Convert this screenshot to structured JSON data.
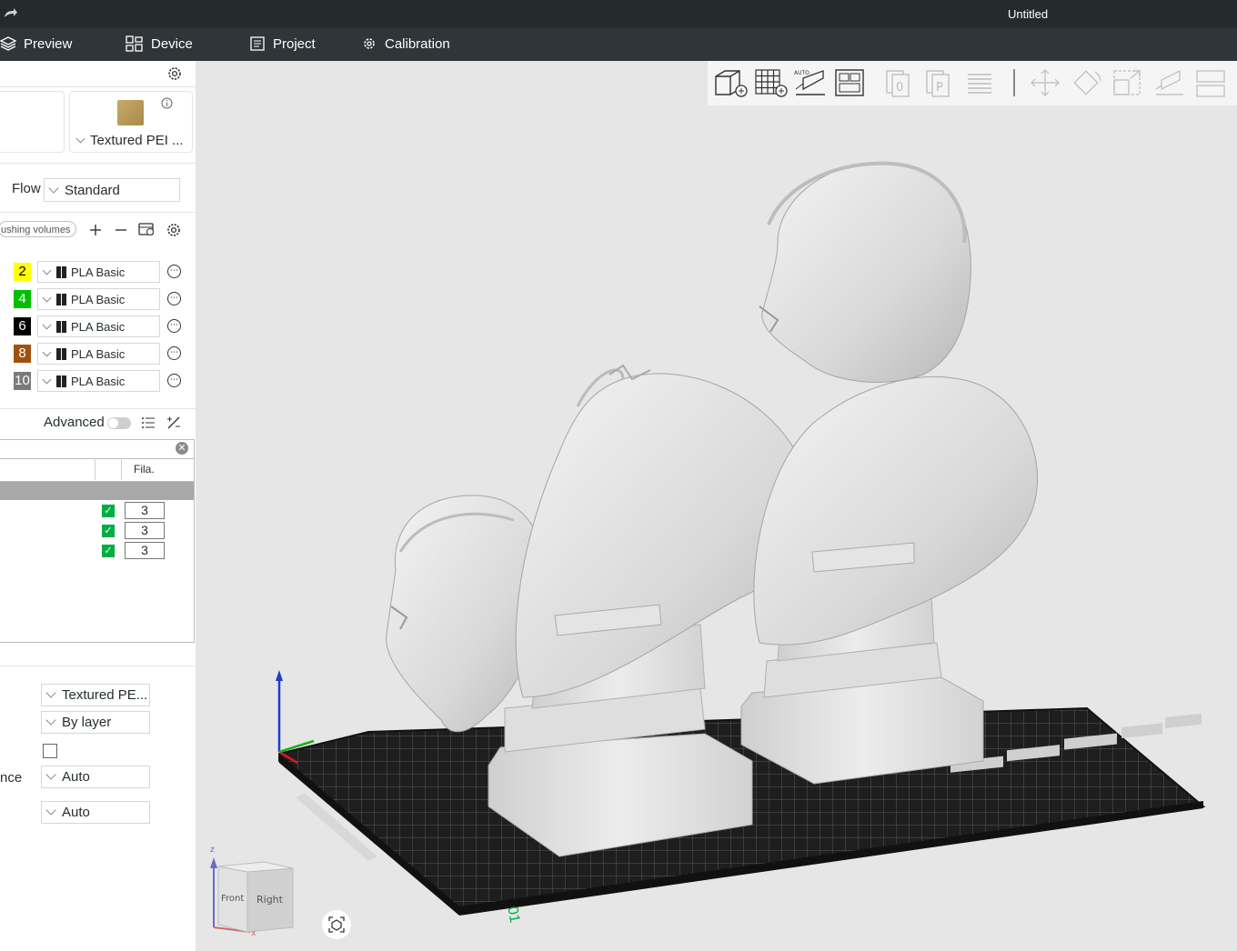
{
  "titlebar": {
    "title": "Untitled"
  },
  "menu": {
    "preview": "Preview",
    "device": "Device",
    "project": "Project",
    "calibration": "Calibration"
  },
  "plate": {
    "label": "Textured PEI ..."
  },
  "flow": {
    "label": "Flow",
    "value": "Standard"
  },
  "filament_bar": {
    "pill": "ushing volumes"
  },
  "filaments": [
    {
      "num": "2",
      "color": "#ffff00",
      "text_color": "#000000",
      "name": "PLA Basic"
    },
    {
      "num": "4",
      "color": "#00c000",
      "text_color": "#ffffff",
      "name": "PLA Basic"
    },
    {
      "num": "6",
      "color": "#000000",
      "text_color": "#ffffff",
      "name": "PLA Basic"
    },
    {
      "num": "8",
      "color": "#a0520a",
      "text_color": "#ffffff",
      "name": "PLA Basic"
    },
    {
      "num": "10",
      "color": "#7a7a7a",
      "text_color": "#ffffff",
      "name": "PLA Basic"
    }
  ],
  "advanced": {
    "label": "Advanced"
  },
  "object_table": {
    "col_header": "Fila.",
    "rows": [
      {
        "value": "3"
      },
      {
        "value": "3"
      },
      {
        "value": "3"
      }
    ]
  },
  "plate_settings": {
    "bed_type": "Textured PE...",
    "sequence": "By layer",
    "partial_label": "nce",
    "option1": "Auto",
    "option2": "Auto"
  },
  "nav_cube": {
    "front": "Front",
    "right": "Right",
    "axis_z": "z",
    "axis_x": "x"
  },
  "plate_number": "01",
  "colors": {
    "accent": "#00ae42",
    "titlebar": "#242b2d",
    "menubar": "#2f3538"
  }
}
